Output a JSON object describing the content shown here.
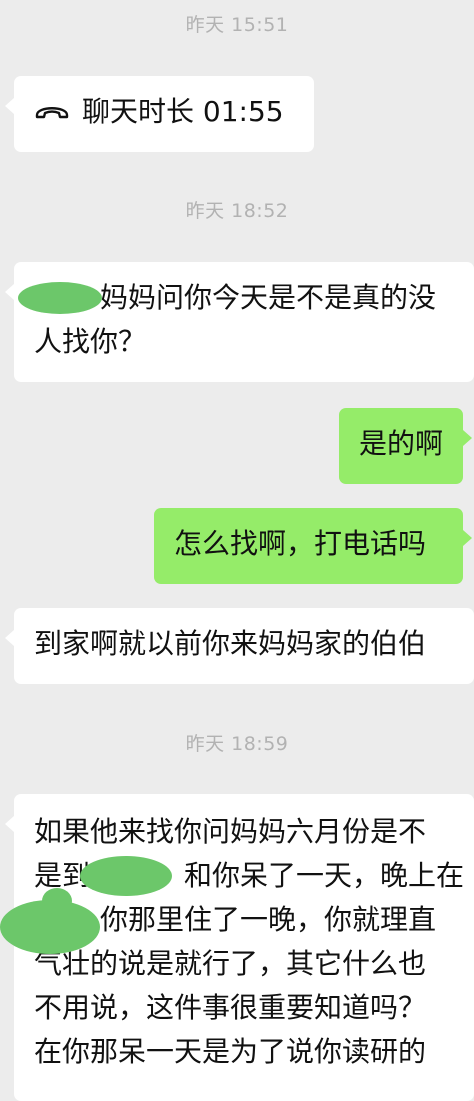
{
  "messages": {
    "ts1": "昨天 15:51",
    "call_label": "聊天时长 01:55",
    "ts2": "昨天 18:52",
    "m1_line1": "妈妈问你今天是不是真的没",
    "m1_line2": "人找你？",
    "m2": "是的啊",
    "m3": "怎么找啊，打电话吗",
    "m4": "到家啊就以前你来妈妈家的伯伯",
    "ts3": "昨天 18:59",
    "m5_line1": "如果他来找你问妈妈六月份是不",
    "m5_line2": "和你呆了一天，晚上在",
    "m5_line2_prefix": "是到",
    "m5_line3": "你那里住了一晚，你就理直",
    "m5_line4": "气壮的说是就行了，其它什么也",
    "m5_line5": "不用说，这件事很重要知道吗？",
    "m5_line6": "在你那呆一天是为了说你读研的"
  },
  "icons": {
    "call": "phone-hangup-icon"
  },
  "colors": {
    "background": "#ececec",
    "incoming_bubble": "#ffffff",
    "outgoing_bubble": "#95ec69",
    "timestamp": "#b2b2b2",
    "redaction": "#6cc76a"
  }
}
